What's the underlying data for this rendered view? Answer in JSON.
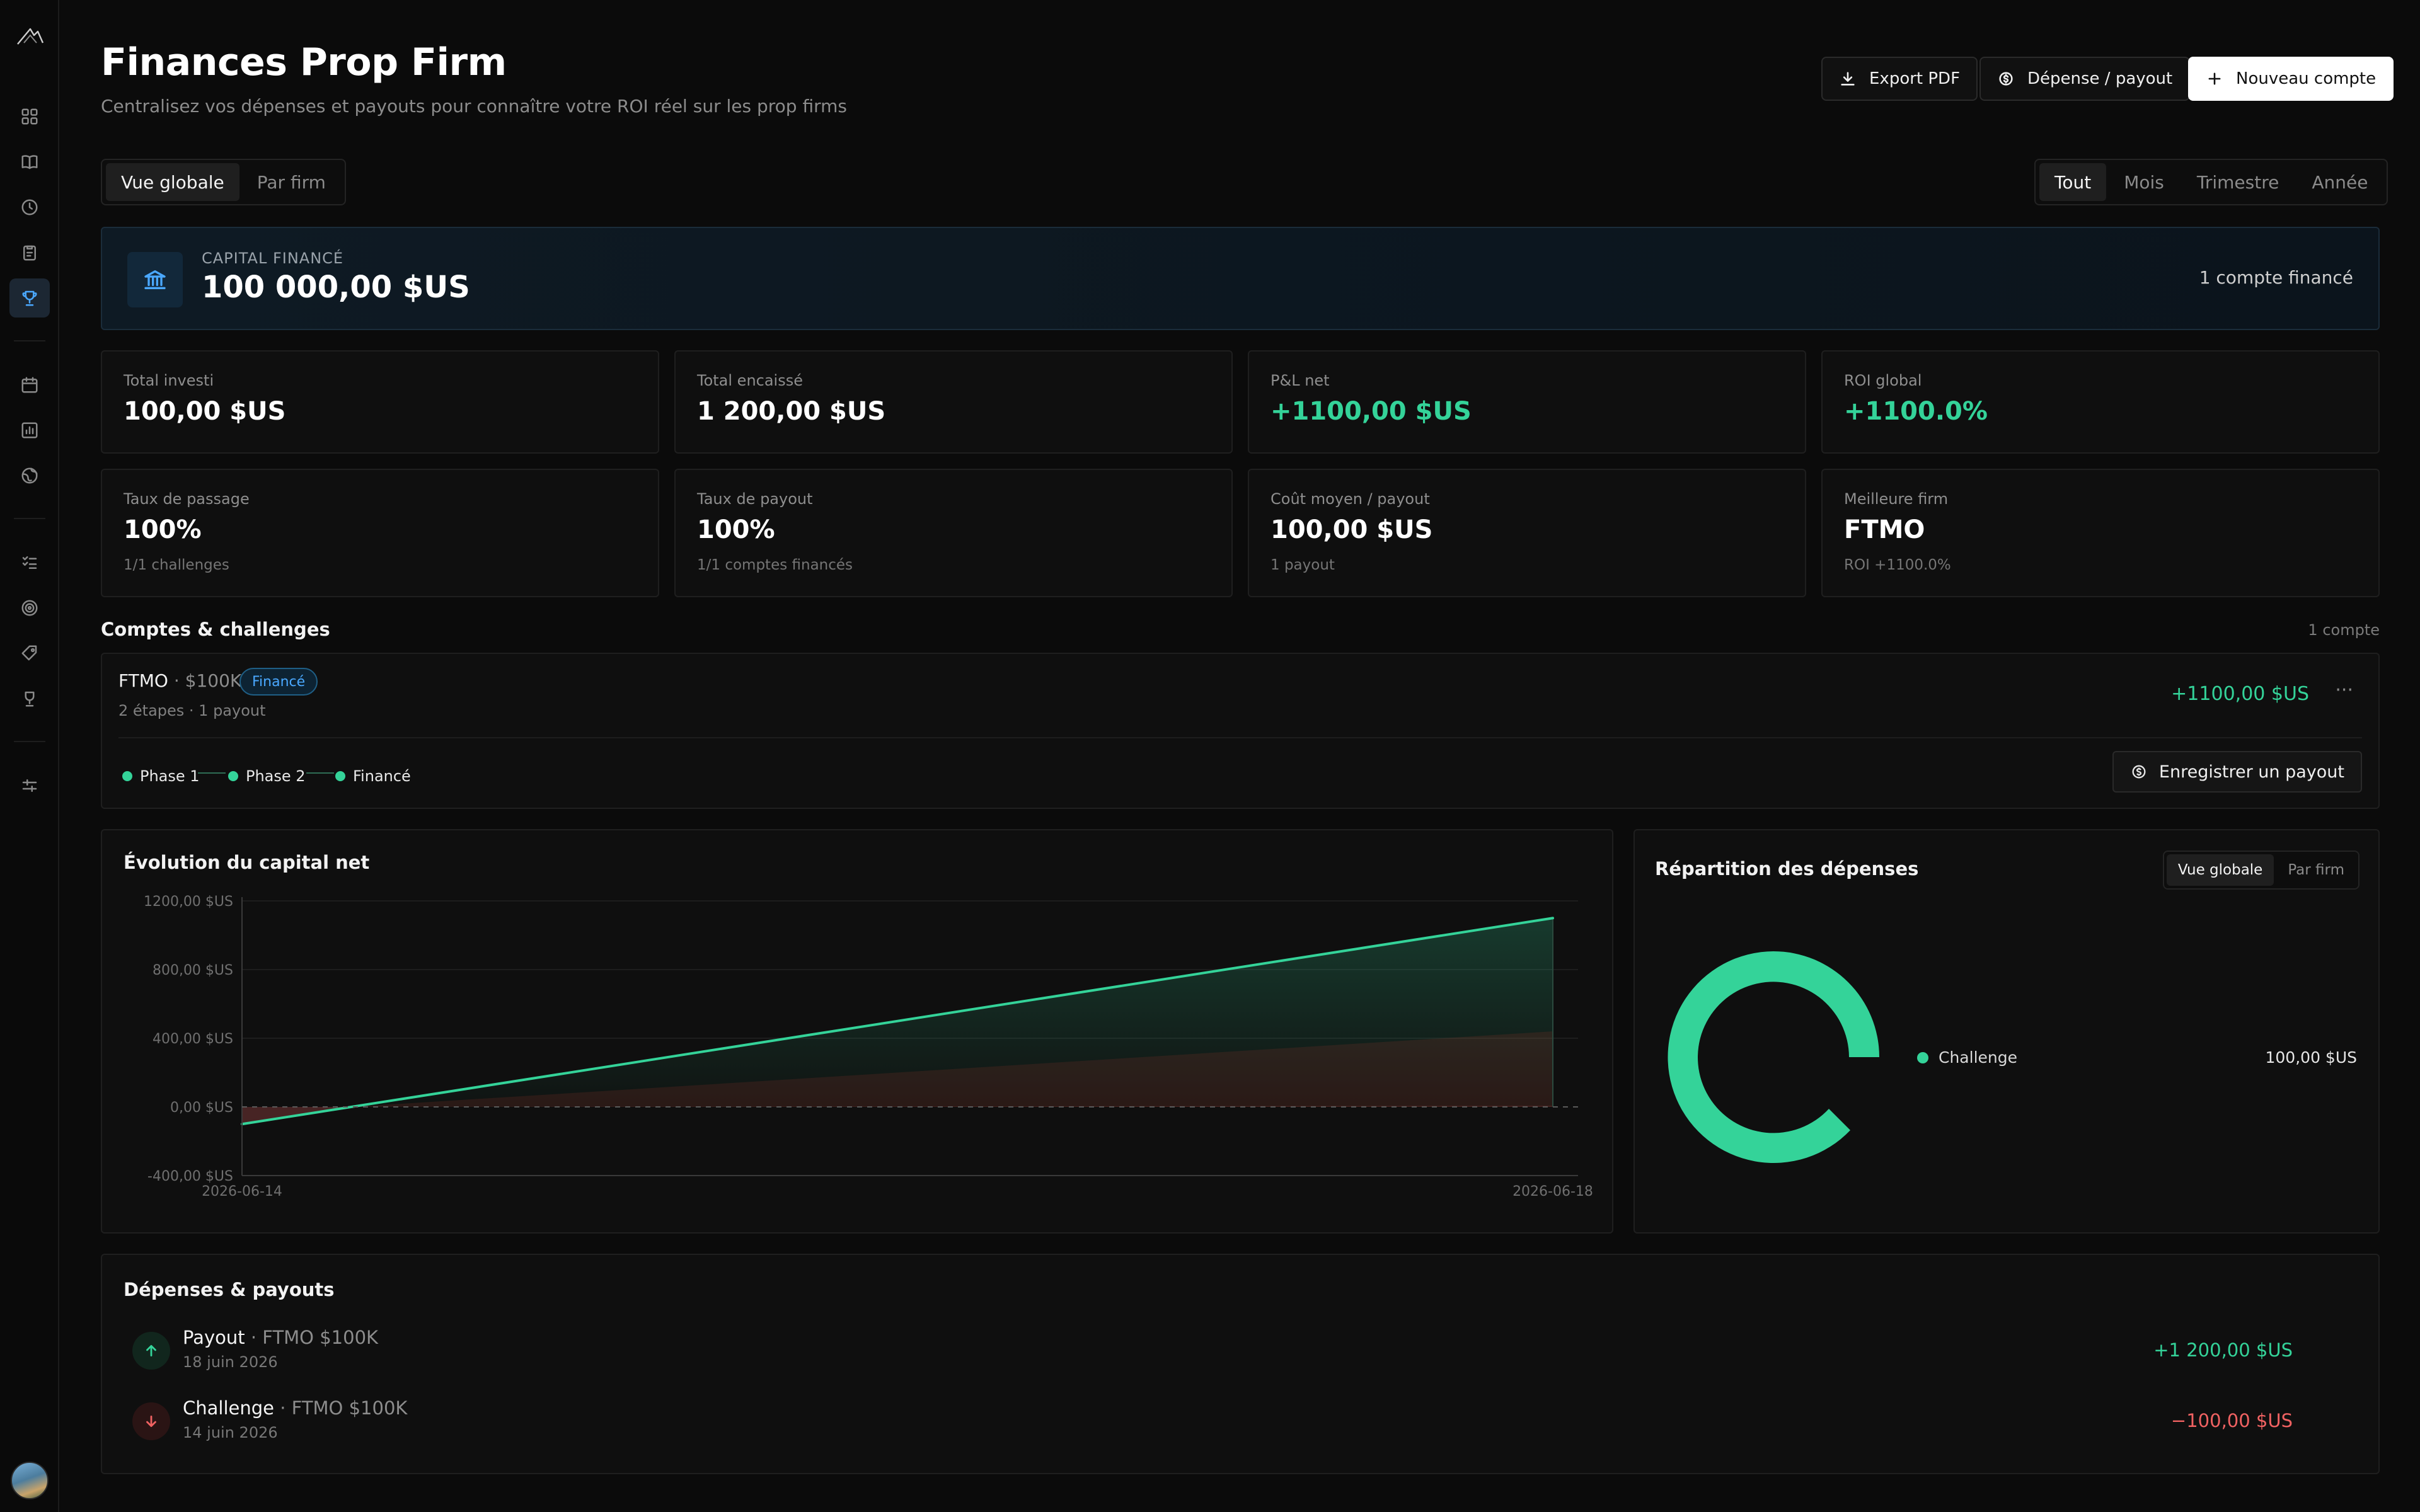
{
  "header": {
    "title": "Finances Prop Firm",
    "subtitle": "Centralisez vos dépenses et payouts pour connaître votre ROI réel sur les prop firms",
    "export_label": "Export PDF",
    "expense_label": "Dépense / payout",
    "new_account_label": "Nouveau compte"
  },
  "view_tabs": [
    "Vue globale",
    "Par firm"
  ],
  "period_tabs": [
    "Tout",
    "Mois",
    "Trimestre",
    "Année"
  ],
  "capital": {
    "label": "CAPITAL FINANCÉ",
    "value": "100 000,00 $US",
    "count": "1 compte financé"
  },
  "stats": [
    {
      "label": "Total investi",
      "value": "100,00 $US",
      "sub": ""
    },
    {
      "label": "Total encaissé",
      "value": "1 200,00 $US",
      "sub": ""
    },
    {
      "label": "P&L net",
      "value": "+1100,00 $US",
      "sub": ""
    },
    {
      "label": "ROI global",
      "value": "+1100.0%",
      "sub": ""
    },
    {
      "label": "Taux de passage",
      "value": "100%",
      "sub": "1/1 challenges"
    },
    {
      "label": "Taux de payout",
      "value": "100%",
      "sub": "1/1 comptes financés"
    },
    {
      "label": "Coût moyen / payout",
      "value": "100,00 $US",
      "sub": "1 payout"
    },
    {
      "label": "Meilleure firm",
      "value": "FTMO",
      "sub": "ROI +1100.0%"
    }
  ],
  "accounts": {
    "title": "Comptes & challenges",
    "count": "1 compte",
    "items": [
      {
        "firm": "FTMO",
        "size": " · $100K",
        "badge": "Financé",
        "meta": "2 étapes · 1 payout",
        "pnl": "+1100,00 $US",
        "more": "···",
        "phases": [
          "Phase 1",
          "Phase 2",
          "Financé"
        ],
        "payout_button": "Enregistrer un payout"
      }
    ]
  },
  "chart": {
    "title": "Évolution du capital net"
  },
  "chart_data": {
    "type": "area",
    "title": "Évolution du capital net",
    "x": [
      "2026-06-14",
      "2026-06-18"
    ],
    "values": [
      -100,
      1100
    ],
    "y_ticks": [
      "1200,00 $US",
      "800,00 $US",
      "400,00 $US",
      "0,00 $US",
      "-400,00 $US"
    ],
    "ylim": [
      -400,
      1200
    ],
    "grid": true,
    "zero_line": "dashed",
    "line_color": "#34d399",
    "xlabel": "",
    "ylabel": ""
  },
  "donut": {
    "title": "Répartition des dépenses",
    "tabs": [
      "Vue globale",
      "Par firm"
    ],
    "slices": [
      {
        "name": "Challenge",
        "value": "100,00 $US",
        "color": "#34d399"
      }
    ]
  },
  "transactions": {
    "title": "Dépenses & payouts",
    "items": [
      {
        "type": "Payout",
        "account": " · FTMO $100K",
        "date": "18 juin 2026",
        "amount": "+1 200,00 $US",
        "direction": "in"
      },
      {
        "type": "Challenge",
        "account": " · FTMO $100K",
        "date": "14 juin 2026",
        "amount": "−100,00 $US",
        "direction": "out"
      }
    ]
  },
  "colors": {
    "positive": "#34d399",
    "negative": "#f06262",
    "accent": "#4aa8ff",
    "background": "#0b0b0b"
  }
}
